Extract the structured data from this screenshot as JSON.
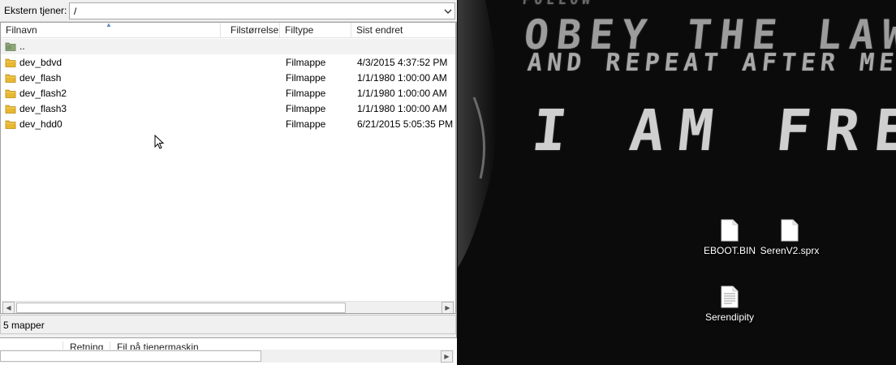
{
  "remote_pane": {
    "path_label": "Ekstern tjener:",
    "path_value": "/",
    "columns": [
      "Filnavn",
      "Filstørrelse",
      "Filtype",
      "Sist endret"
    ],
    "parent_entry": "..",
    "entries": [
      {
        "name": "dev_bdvd",
        "type": "Filmappe",
        "modified": "4/3/2015 4:37:52 PM"
      },
      {
        "name": "dev_flash",
        "type": "Filmappe",
        "modified": "1/1/1980 1:00:00 AM"
      },
      {
        "name": "dev_flash2",
        "type": "Filmappe",
        "modified": "1/1/1980 1:00:00 AM"
      },
      {
        "name": "dev_flash3",
        "type": "Filmappe",
        "modified": "1/1/1980 1:00:00 AM"
      },
      {
        "name": "dev_hdd0",
        "type": "Filmappe",
        "modified": "6/21/2015 5:05:35 PM"
      }
    ],
    "status": "5 mapper"
  },
  "queue": {
    "columns": [
      "Retning",
      "Fil på tjenermaskin"
    ]
  },
  "desktop": {
    "wallpaper_lines": [
      "FOLLOW",
      "OBEY THE LAW",
      "AND REPEAT AFTER ME",
      "I AM FREE"
    ],
    "icons": [
      {
        "label": "EBOOT.BIN",
        "icon": "file-icon"
      },
      {
        "label": "SerenV2.sprx",
        "icon": "file-icon"
      },
      {
        "label": "Serendipity",
        "icon": "text-file-icon"
      }
    ]
  },
  "colors": {
    "folder": "#e8b830",
    "pane_bg": "#f0f0f0",
    "desktop_bg": "#0b0b0b"
  }
}
